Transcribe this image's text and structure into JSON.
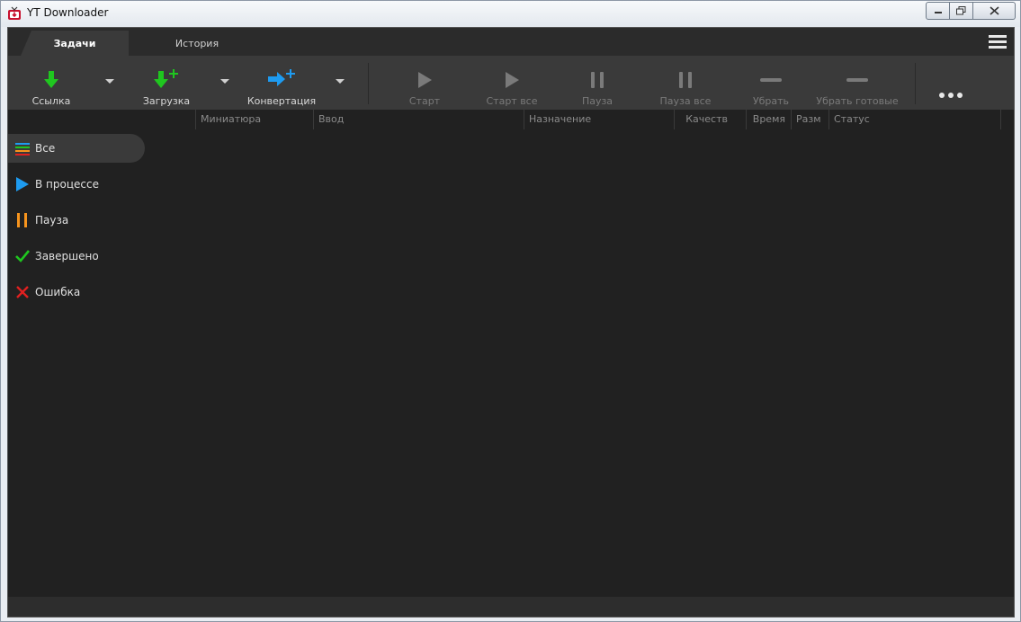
{
  "window": {
    "title": "YT Downloader"
  },
  "tabs": [
    {
      "label": "Задачи",
      "active": true
    },
    {
      "label": "История",
      "active": false
    }
  ],
  "toolbar": {
    "link_label": "Ссылка",
    "download_label": "Загрузка",
    "convert_label": "Конвертация",
    "start_label": "Старт",
    "start_all_label": "Старт все",
    "pause_label": "Пауза",
    "pause_all_label": "Пауза все",
    "remove_label": "Убрать",
    "remove_done_label": "Убрать готовые",
    "more_label": "•••"
  },
  "columns": [
    "Миниатюра",
    "Ввод",
    "Назначение",
    "Качеств",
    "Время",
    "Разм",
    "Статус"
  ],
  "sidebar": {
    "items": [
      {
        "label": "Все",
        "icon": "list-icon",
        "active": true
      },
      {
        "label": "В процессе",
        "icon": "play-icon",
        "active": false
      },
      {
        "label": "Пауза",
        "icon": "pause-icon",
        "active": false
      },
      {
        "label": "Завершено",
        "icon": "check-icon",
        "active": false
      },
      {
        "label": "Ошибка",
        "icon": "error-x-icon",
        "active": false
      }
    ]
  },
  "colors": {
    "green": "#1fc61f",
    "blue": "#1e9bf0",
    "orange": "#f7941d",
    "red": "#e02020",
    "background": "#212121",
    "toolbar": "#3a3a3a"
  }
}
